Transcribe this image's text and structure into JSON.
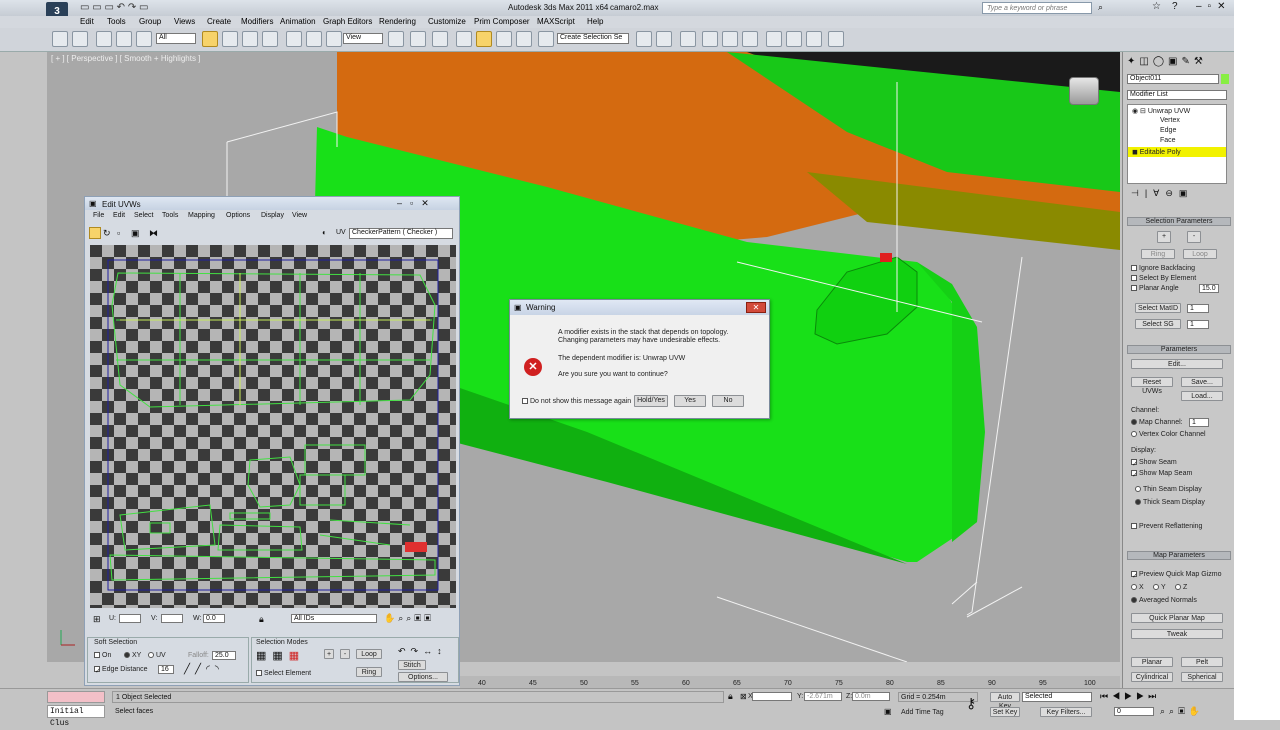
{
  "app": {
    "title": "Autodesk 3ds Max  2011 x64",
    "file": "camaro2.max",
    "search_placeholder": "Type a keyword or phrase"
  },
  "menu": [
    "Edit",
    "Tools",
    "Group",
    "Views",
    "Create",
    "Modifiers",
    "Animation",
    "Graph Editors",
    "Rendering",
    "Customize",
    "Prim Composer",
    "MAXScript",
    "Help"
  ],
  "toolbar": {
    "filter": "All",
    "refcoord": "View",
    "selset": "Create Selection Se"
  },
  "viewport": {
    "label": "[ + ] [ Perspective ] [ Smooth + Highlights ]"
  },
  "uvw": {
    "title": "Edit UVWs",
    "menu": [
      "File",
      "Edit",
      "Select",
      "Tools",
      "Mapping",
      "Options",
      "Display",
      "View"
    ],
    "uv_label": "UV",
    "texture": "CheckerPattern  ( Checker )",
    "u_label": "U:",
    "v_label": "V:",
    "w_label": "W:",
    "w_value": "0.0",
    "ids": "All IDs",
    "soft_selection": "Soft Selection",
    "on": "On",
    "xy": "XY",
    "uv": "UV",
    "falloff": "Falloff:",
    "falloff_value": "25.0",
    "edge_distance": "Edge Distance",
    "edge_value": "16",
    "selection_modes": "Selection Modes",
    "select_element": "Select Element",
    "loop": "Loop",
    "ring": "Ring",
    "stitch": "Stitch",
    "options": "Options..."
  },
  "warning": {
    "title": "Warning",
    "line1": "A modifier exists in the stack that depends on topology.",
    "line2": "Changing parameters may have undesirable effects.",
    "line3": "The dependent modifier is:  Unwrap UVW",
    "line4": "Are you sure you want to continue?",
    "dont_show": "Do not show this message again",
    "hold_yes": "Hold/Yes",
    "yes": "Yes",
    "no": "No"
  },
  "cmd": {
    "object_name": "Object011",
    "modifier_list": "Modifier List",
    "stack": [
      "Unwrap UVW",
      "Vertex",
      "Edge",
      "Face",
      "Editable Poly"
    ],
    "sel_params": "Selection Parameters",
    "ring": "Ring",
    "loop": "Loop",
    "ignore_backfacing": "Ignore Backfacing",
    "select_by_element": "Select By Element",
    "planar_angle": "Planar Angle",
    "planar_value": "15.0",
    "select_matid": "Select MatID",
    "select_sg": "Select SG",
    "id_value": "1",
    "parameters": "Parameters",
    "edit": "Edit...",
    "reset": "Reset UVWs",
    "save": "Save...",
    "load": "Load...",
    "channel": "Channel:",
    "map_channel": "Map Channel:",
    "map_value": "1",
    "vertex_color": "Vertex Color Channel",
    "display": "Display:",
    "show_seam": "Show Seam",
    "show_map_seam": "Show Map Seam",
    "thin_seam": "Thin Seam Display",
    "thick_seam": "Thick Seam Display",
    "prevent": "Prevent Reflattening",
    "map_params": "Map Parameters",
    "preview_gizmo": "Preview Quick Map Gizmo",
    "x": "X",
    "y": "Y",
    "z": "Z",
    "averaged": "Averaged Normals",
    "quick_planar": "Quick Planar Map",
    "tweak": "Tweak",
    "planar": "Planar",
    "pelt": "Pelt",
    "cylindrical": "Cylindrical",
    "spherical": "Spherical"
  },
  "timeline": {
    "ticks": [
      "40",
      "45",
      "50",
      "55",
      "60",
      "65",
      "70",
      "75",
      "80",
      "85",
      "90",
      "95",
      "100"
    ]
  },
  "status": {
    "listener": "Initial Clus",
    "selected": "1 Object Selected",
    "prompt": "Select faces",
    "x_label": "X:",
    "y_label": "Y:",
    "y_value": "-2.671m",
    "z_label": "Z:",
    "z_value": "0.0m",
    "grid": "Grid = 0.254m",
    "add_time_tag": "Add Time Tag",
    "auto_key": "Auto Key",
    "set_key": "Set Key",
    "selected_filter": "Selected",
    "key_filters": "Key Filters...",
    "frame": "0"
  },
  "colors": {
    "green": "#18e018",
    "orange": "#d46a10",
    "warning_red": "#d02020",
    "stack_highlight": "#f2f200"
  }
}
